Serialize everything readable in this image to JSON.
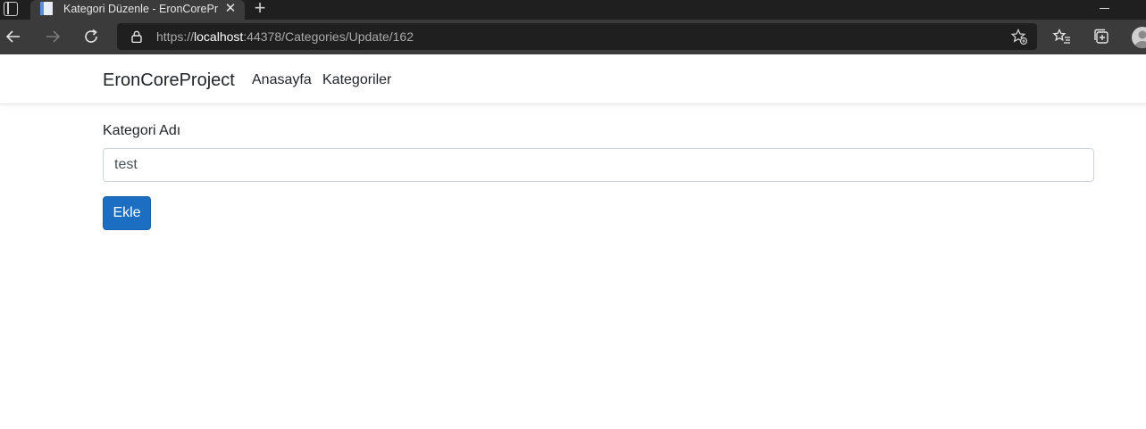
{
  "browser": {
    "tab": {
      "title": "Kategori Düzenle - EronCoreProject",
      "close_icon": "close-icon",
      "favicon": "page-icon"
    },
    "new_tab_icon": "plus-icon",
    "address_bar": {
      "scheme": "https://",
      "host": "localhost",
      "rest": ":44378/Categories/Update/162"
    }
  },
  "navbar": {
    "brand": "EronCoreProject",
    "links": [
      "Anasayfa",
      "Kategoriler"
    ]
  },
  "form": {
    "label": "Kategori Adı",
    "value": "test",
    "submit_label": "Ekle"
  },
  "colors": {
    "primary_button": "#1b6ec2",
    "chrome_dark": "#1f1f1f",
    "chrome_toolbar": "#3b3b3b"
  }
}
